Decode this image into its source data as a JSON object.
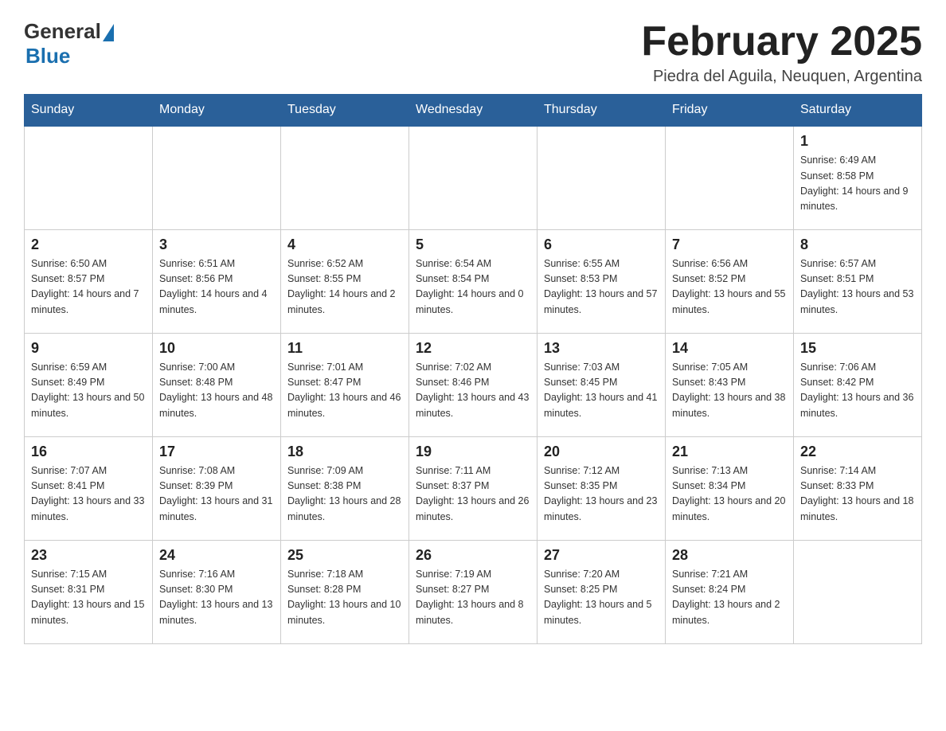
{
  "logo": {
    "general": "General",
    "blue": "Blue"
  },
  "header": {
    "month_year": "February 2025",
    "location": "Piedra del Aguila, Neuquen, Argentina"
  },
  "days_of_week": [
    "Sunday",
    "Monday",
    "Tuesday",
    "Wednesday",
    "Thursday",
    "Friday",
    "Saturday"
  ],
  "weeks": [
    [
      {
        "day": "",
        "info": ""
      },
      {
        "day": "",
        "info": ""
      },
      {
        "day": "",
        "info": ""
      },
      {
        "day": "",
        "info": ""
      },
      {
        "day": "",
        "info": ""
      },
      {
        "day": "",
        "info": ""
      },
      {
        "day": "1",
        "info": "Sunrise: 6:49 AM\nSunset: 8:58 PM\nDaylight: 14 hours and 9 minutes."
      }
    ],
    [
      {
        "day": "2",
        "info": "Sunrise: 6:50 AM\nSunset: 8:57 PM\nDaylight: 14 hours and 7 minutes."
      },
      {
        "day": "3",
        "info": "Sunrise: 6:51 AM\nSunset: 8:56 PM\nDaylight: 14 hours and 4 minutes."
      },
      {
        "day": "4",
        "info": "Sunrise: 6:52 AM\nSunset: 8:55 PM\nDaylight: 14 hours and 2 minutes."
      },
      {
        "day": "5",
        "info": "Sunrise: 6:54 AM\nSunset: 8:54 PM\nDaylight: 14 hours and 0 minutes."
      },
      {
        "day": "6",
        "info": "Sunrise: 6:55 AM\nSunset: 8:53 PM\nDaylight: 13 hours and 57 minutes."
      },
      {
        "day": "7",
        "info": "Sunrise: 6:56 AM\nSunset: 8:52 PM\nDaylight: 13 hours and 55 minutes."
      },
      {
        "day": "8",
        "info": "Sunrise: 6:57 AM\nSunset: 8:51 PM\nDaylight: 13 hours and 53 minutes."
      }
    ],
    [
      {
        "day": "9",
        "info": "Sunrise: 6:59 AM\nSunset: 8:49 PM\nDaylight: 13 hours and 50 minutes."
      },
      {
        "day": "10",
        "info": "Sunrise: 7:00 AM\nSunset: 8:48 PM\nDaylight: 13 hours and 48 minutes."
      },
      {
        "day": "11",
        "info": "Sunrise: 7:01 AM\nSunset: 8:47 PM\nDaylight: 13 hours and 46 minutes."
      },
      {
        "day": "12",
        "info": "Sunrise: 7:02 AM\nSunset: 8:46 PM\nDaylight: 13 hours and 43 minutes."
      },
      {
        "day": "13",
        "info": "Sunrise: 7:03 AM\nSunset: 8:45 PM\nDaylight: 13 hours and 41 minutes."
      },
      {
        "day": "14",
        "info": "Sunrise: 7:05 AM\nSunset: 8:43 PM\nDaylight: 13 hours and 38 minutes."
      },
      {
        "day": "15",
        "info": "Sunrise: 7:06 AM\nSunset: 8:42 PM\nDaylight: 13 hours and 36 minutes."
      }
    ],
    [
      {
        "day": "16",
        "info": "Sunrise: 7:07 AM\nSunset: 8:41 PM\nDaylight: 13 hours and 33 minutes."
      },
      {
        "day": "17",
        "info": "Sunrise: 7:08 AM\nSunset: 8:39 PM\nDaylight: 13 hours and 31 minutes."
      },
      {
        "day": "18",
        "info": "Sunrise: 7:09 AM\nSunset: 8:38 PM\nDaylight: 13 hours and 28 minutes."
      },
      {
        "day": "19",
        "info": "Sunrise: 7:11 AM\nSunset: 8:37 PM\nDaylight: 13 hours and 26 minutes."
      },
      {
        "day": "20",
        "info": "Sunrise: 7:12 AM\nSunset: 8:35 PM\nDaylight: 13 hours and 23 minutes."
      },
      {
        "day": "21",
        "info": "Sunrise: 7:13 AM\nSunset: 8:34 PM\nDaylight: 13 hours and 20 minutes."
      },
      {
        "day": "22",
        "info": "Sunrise: 7:14 AM\nSunset: 8:33 PM\nDaylight: 13 hours and 18 minutes."
      }
    ],
    [
      {
        "day": "23",
        "info": "Sunrise: 7:15 AM\nSunset: 8:31 PM\nDaylight: 13 hours and 15 minutes."
      },
      {
        "day": "24",
        "info": "Sunrise: 7:16 AM\nSunset: 8:30 PM\nDaylight: 13 hours and 13 minutes."
      },
      {
        "day": "25",
        "info": "Sunrise: 7:18 AM\nSunset: 8:28 PM\nDaylight: 13 hours and 10 minutes."
      },
      {
        "day": "26",
        "info": "Sunrise: 7:19 AM\nSunset: 8:27 PM\nDaylight: 13 hours and 8 minutes."
      },
      {
        "day": "27",
        "info": "Sunrise: 7:20 AM\nSunset: 8:25 PM\nDaylight: 13 hours and 5 minutes."
      },
      {
        "day": "28",
        "info": "Sunrise: 7:21 AM\nSunset: 8:24 PM\nDaylight: 13 hours and 2 minutes."
      },
      {
        "day": "",
        "info": ""
      }
    ]
  ]
}
